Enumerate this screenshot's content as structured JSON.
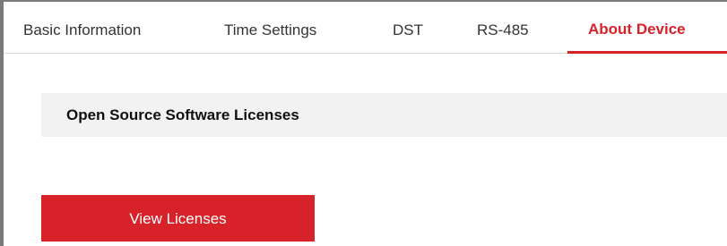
{
  "tabs": [
    {
      "label": "Basic Information",
      "active": false
    },
    {
      "label": "Time Settings",
      "active": false
    },
    {
      "label": "DST",
      "active": false
    },
    {
      "label": "RS-485",
      "active": false
    },
    {
      "label": "About Device",
      "active": true
    }
  ],
  "section": {
    "title": "Open Source Software Licenses"
  },
  "actions": {
    "view_licenses_label": "View Licenses"
  },
  "colors": {
    "accent": "#d7222a",
    "section_background": "#f2f2f2",
    "frame_border": "#7a7a7a",
    "text": "#333333"
  }
}
